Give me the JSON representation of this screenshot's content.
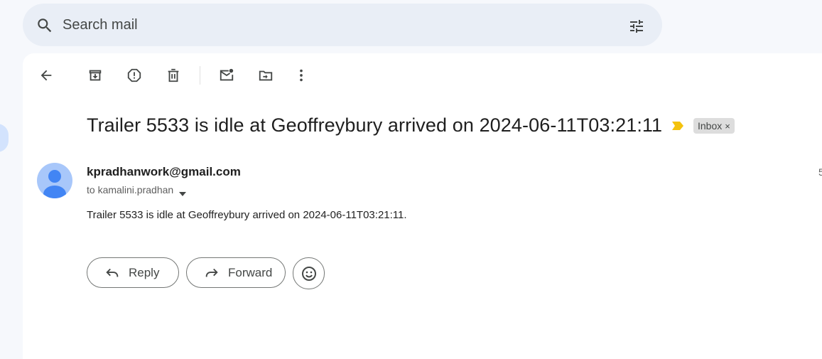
{
  "search": {
    "placeholder": "Search mail",
    "search_icon": "search-icon",
    "options_icon": "tune-icon"
  },
  "toolbar": {
    "icons": [
      "back-arrow-icon",
      "archive-icon",
      "report-spam-icon",
      "delete-icon",
      "mark-unread-icon",
      "move-to-icon",
      "more-vert-icon"
    ]
  },
  "email": {
    "subject": "Trailer 5533 is idle at Geoffreybury arrived on 2024-06-11T03:21:11",
    "label": "Inbox",
    "label_remove": "×",
    "sender": "kpradhanwork@gmail.com",
    "to_line": "to kamalini.pradhan",
    "time_partial": "5",
    "body": "Trailer 5533 is idle at Geoffreybury arrived on 2024-06-11T03:21:11."
  },
  "actions": {
    "reply_label": "Reply",
    "forward_label": "Forward"
  },
  "colors": {
    "importance_marker": "#f4c20d",
    "avatar_bg": "#a8c7fa",
    "avatar_figure": "#4285f4",
    "search_bg": "#e9eef6",
    "page_bg": "#f6f8fc"
  }
}
